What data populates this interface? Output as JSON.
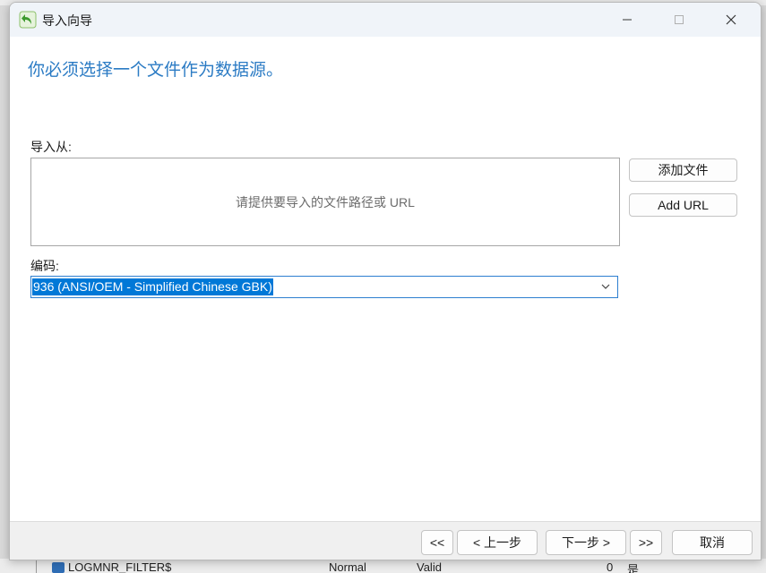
{
  "dialog": {
    "title": "导入向导",
    "heading": "你必须选择一个文件作为数据源。"
  },
  "import_from": {
    "label": "导入从:",
    "placeholder": "请提供要导入的文件路径或 URL",
    "add_file_label": "添加文件",
    "add_url_label": "Add URL"
  },
  "encoding": {
    "label": "编码:",
    "selected": "936 (ANSI/OEM - Simplified Chinese GBK)"
  },
  "footer": {
    "first_label": "<<",
    "prev_label": "< 上一步",
    "next_label": "下一步 >",
    "last_label": ">>",
    "cancel_label": "取消"
  },
  "background": {
    "row_name": "LOGMNR_FILTER$",
    "row_type": "Normal",
    "row_status": "Valid",
    "row_count": "0",
    "row_extra": "是"
  },
  "colors": {
    "heading": "#2b7bc4",
    "selection": "#0078d7",
    "title_bar": "#f0f4f9"
  }
}
